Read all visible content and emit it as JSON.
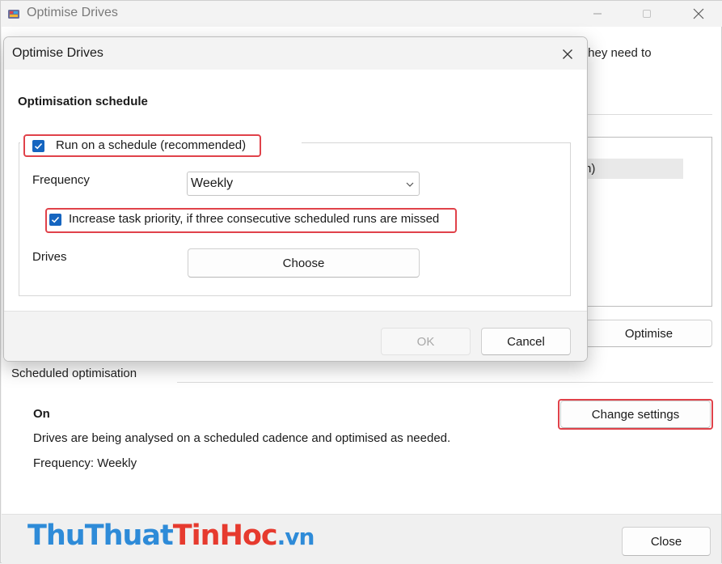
{
  "window": {
    "title": "Optimise Drives",
    "description_tail": "they need to",
    "drive_row_tail": "n)",
    "optimise_label": "Optimise",
    "close_label": "Close"
  },
  "scheduled": {
    "heading": "Scheduled optimisation",
    "status": "On",
    "description": "Drives are being analysed on a scheduled cadence and optimised as needed.",
    "frequency_text": "Frequency: Weekly",
    "change_settings_label": "Change settings"
  },
  "dialog": {
    "title": "Optimise Drives",
    "heading": "Optimisation schedule",
    "run_on_schedule": {
      "label": "Run on a schedule (recommended)",
      "checked": true
    },
    "frequency_label": "Frequency",
    "frequency_value": "Weekly",
    "increase_priority": {
      "label": "Increase task priority, if three consecutive scheduled runs are missed",
      "checked": true
    },
    "drives_label": "Drives",
    "choose_label": "Choose",
    "ok_label": "OK",
    "cancel_label": "Cancel"
  },
  "watermark": {
    "part1": "ThuThuat",
    "part2": "TinHoc",
    "part3": ".vn"
  },
  "colors": {
    "accent": "#1565c0",
    "highlight": "#e0424a",
    "watermark_blue": "#2e8bd8",
    "watermark_red": "#e63a2e"
  }
}
